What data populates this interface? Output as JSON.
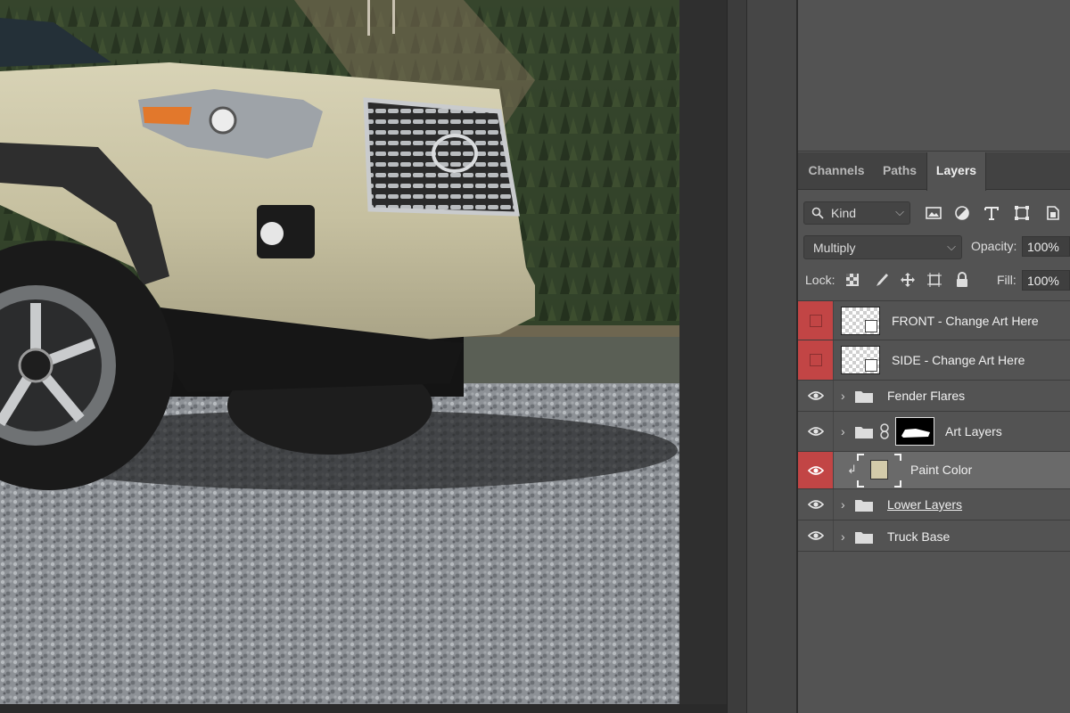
{
  "panel": {
    "tabs": [
      {
        "label": "Channels",
        "active": false
      },
      {
        "label": "Paths",
        "active": false
      },
      {
        "label": "Layers",
        "active": true
      }
    ],
    "filter": {
      "kind_label": "Kind",
      "icons": [
        "image-filter-icon",
        "adjustment-filter-icon",
        "type-filter-icon",
        "shape-filter-icon",
        "smart-object-filter-icon"
      ]
    },
    "blend_mode": "Multiply",
    "opacity_label": "Opacity:",
    "opacity_value": "100%",
    "lock_label": "Lock:",
    "lock_icons": [
      "lock-transparent-icon",
      "lock-image-icon",
      "lock-position-icon",
      "lock-artboard-icon",
      "lock-all-icon"
    ],
    "fill_label": "Fill:",
    "fill_value": "100%"
  },
  "layers": [
    {
      "name": "FRONT - Change Art Here",
      "type": "smart-object",
      "visible": false
    },
    {
      "name": "SIDE - Change Art Here",
      "type": "smart-object",
      "visible": false
    },
    {
      "name": "Fender Flares",
      "type": "group",
      "visible": true
    },
    {
      "name": "Art Layers",
      "type": "group-with-mask",
      "visible": true
    },
    {
      "name": "Paint Color",
      "type": "fill-clipped",
      "visible": true,
      "selected": true,
      "swatch_color": "#d3cbaa"
    },
    {
      "name": "Lower Layers",
      "type": "group",
      "visible": true
    },
    {
      "name": "Truck Base",
      "type": "group",
      "visible": true
    }
  ],
  "colors": {
    "accent_red": "#c24545",
    "truck_paint": "#c9c3a3"
  }
}
